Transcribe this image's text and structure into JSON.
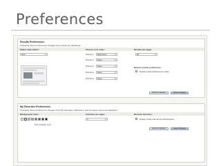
{
  "page": {
    "title": "Preferences"
  },
  "results": {
    "title": "Results Preferences:",
    "description": "Changing these preferences changes how results are displayed.",
    "col1_header": "Select view option:",
    "col2_header": "Choose sort order:",
    "col3_header": "Results per page:",
    "view_value": "Grid",
    "priority_labels": [
      "Priority 1:",
      "Priority 2:",
      "Priority 3:",
      "Priority 4:",
      "Priority 5:"
    ],
    "priority_values": [
      "Relevance",
      "None",
      "None",
      "None",
      "None"
    ],
    "per_page_value": "20",
    "remove_header": "Remove results preferences:",
    "remove_label": "Delete results preferences cookie",
    "restore_label": "Restore defaults",
    "save_label": "Save Changes"
  },
  "favorites": {
    "title": "My Favorites Preferences:",
    "description": "Changing these preferences changes how My Favorites, Slideshow, and Compare views are displayed.",
    "col1_header": "Background color:",
    "col2_header": "Columns per page:",
    "col3_header": "Remove favorites:",
    "columns_value": "3",
    "remove_label": "Delete cookie and remove all Favorites",
    "swatches": [
      "#ffffff",
      "#e6e6e6",
      "#cccccc",
      "#a6a6a6",
      "#808080",
      "#5b5b5b",
      "#3a3a3a",
      "#1a1a1a"
    ],
    "selected_swatch": 1,
    "text_color_label": "Text color:",
    "text_color_value": "Edit color",
    "restore_label": "Restore defaults",
    "save_label": "Save Changes"
  }
}
